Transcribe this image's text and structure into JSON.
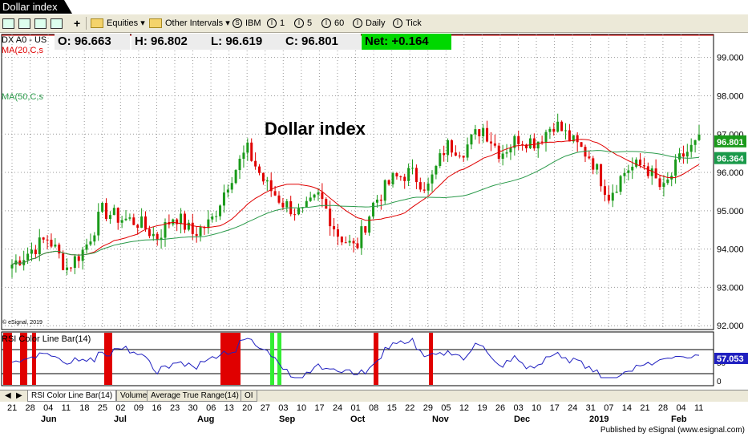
{
  "window": {
    "title": "Dollar index"
  },
  "toolbar": {
    "equities": "Equities",
    "other_intervals": "Other Intervals",
    "intervals": [
      "IBM",
      "1",
      "5",
      "60",
      "Daily",
      "Tick"
    ]
  },
  "quote": {
    "symbol": "DX A0 - US",
    "open": "O: 96.663",
    "high": "H: 96.802",
    "low": "L: 96.619",
    "close": "C: 96.801",
    "net": "Net: +0.164"
  },
  "indicators": {
    "ma20": "MA(20,C,s",
    "ma50": "MA(50,C,s",
    "rsi": "RSI Color Line Bar(14)",
    "esignal": "© eSignal, 2019"
  },
  "chart_data": {
    "type": "candlestick",
    "title": "Dollar index",
    "ylim": [
      92,
      99.5
    ],
    "y_ticks": [
      "99.000",
      "98.000",
      "97.000",
      "96.000",
      "95.000",
      "94.000",
      "93.000",
      "92.000"
    ],
    "last_price_label": "96.801",
    "ma_label": "96.364",
    "rsi_value_label": "57.053",
    "rsi_ticks": [
      "50",
      "0"
    ],
    "x_day_labels": [
      "21",
      "28",
      "04",
      "11",
      "18",
      "25",
      "02",
      "09",
      "16",
      "23",
      "30",
      "06",
      "13",
      "20",
      "27",
      "03",
      "10",
      "17",
      "24",
      "01",
      "08",
      "15",
      "22",
      "29",
      "05",
      "12",
      "19",
      "26",
      "03",
      "10",
      "17",
      "24",
      "31",
      "07",
      "14",
      "21",
      "28",
      "04",
      "11"
    ],
    "x_month_labels": [
      "Jun",
      "Jul",
      "Aug",
      "Sep",
      "Oct",
      "Nov",
      "Dec",
      "2019",
      "Feb"
    ],
    "colors": {
      "up": "#1a9a1a",
      "down": "#e00000",
      "ma20": "#e00000",
      "ma50": "#2a9a4a",
      "rsi": "#2020c0"
    }
  },
  "tabs": [
    "RSI Color Line Bar(14)",
    "Volume",
    "Average True Range(14)",
    "OI"
  ],
  "footer": "Published by eSignal (www.esignal.com)"
}
